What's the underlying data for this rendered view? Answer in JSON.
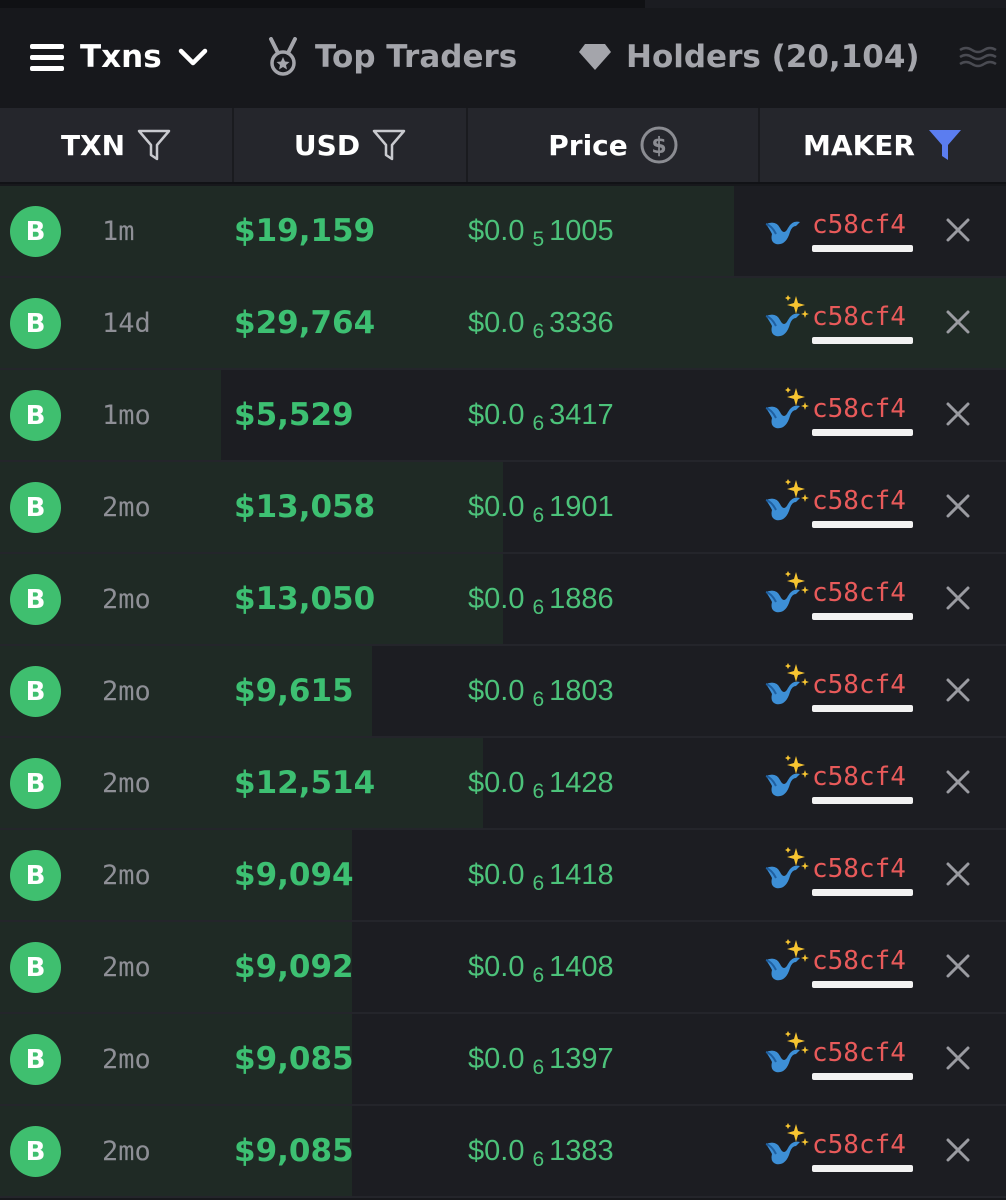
{
  "tabs": {
    "txns": "Txns",
    "top_traders": "Top Traders",
    "holders": "Holders (20,104)"
  },
  "header": {
    "txn": "TXN",
    "usd": "USD",
    "price": "Price",
    "maker": "MAKER"
  },
  "colors": {
    "buy_green": "#3dc072",
    "maker_red": "#e85a5a",
    "filter_active": "#5b7df0"
  },
  "rows": [
    {
      "type": "B",
      "age": "1m",
      "usd": "$19,159",
      "price_prefix": "$0.0",
      "price_zeros": "5",
      "price_digits": "1005",
      "maker": "c58cf4",
      "maker_icon": "whale-icon",
      "fill": 0.73
    },
    {
      "type": "B",
      "age": "14d",
      "usd": "$29,764",
      "price_prefix": "$0.0",
      "price_zeros": "6",
      "price_digits": "3336",
      "maker": "c58cf4",
      "maker_icon": "sparkle-whale-icon",
      "fill": 1.0
    },
    {
      "type": "B",
      "age": "1mo",
      "usd": "$5,529",
      "price_prefix": "$0.0",
      "price_zeros": "6",
      "price_digits": "3417",
      "maker": "c58cf4",
      "maker_icon": "sparkle-whale-icon",
      "fill": 0.22
    },
    {
      "type": "B",
      "age": "2mo",
      "usd": "$13,058",
      "price_prefix": "$0.0",
      "price_zeros": "6",
      "price_digits": "1901",
      "maker": "c58cf4",
      "maker_icon": "sparkle-whale-icon",
      "fill": 0.5
    },
    {
      "type": "B",
      "age": "2mo",
      "usd": "$13,050",
      "price_prefix": "$0.0",
      "price_zeros": "6",
      "price_digits": "1886",
      "maker": "c58cf4",
      "maker_icon": "sparkle-whale-icon",
      "fill": 0.5
    },
    {
      "type": "B",
      "age": "2mo",
      "usd": "$9,615",
      "price_prefix": "$0.0",
      "price_zeros": "6",
      "price_digits": "1803",
      "maker": "c58cf4",
      "maker_icon": "sparkle-whale-icon",
      "fill": 0.37
    },
    {
      "type": "B",
      "age": "2mo",
      "usd": "$12,514",
      "price_prefix": "$0.0",
      "price_zeros": "6",
      "price_digits": "1428",
      "maker": "c58cf4",
      "maker_icon": "sparkle-whale-icon",
      "fill": 0.48
    },
    {
      "type": "B",
      "age": "2mo",
      "usd": "$9,094",
      "price_prefix": "$0.0",
      "price_zeros": "6",
      "price_digits": "1418",
      "maker": "c58cf4",
      "maker_icon": "sparkle-whale-icon",
      "fill": 0.35
    },
    {
      "type": "B",
      "age": "2mo",
      "usd": "$9,092",
      "price_prefix": "$0.0",
      "price_zeros": "6",
      "price_digits": "1408",
      "maker": "c58cf4",
      "maker_icon": "sparkle-whale-icon",
      "fill": 0.35
    },
    {
      "type": "B",
      "age": "2mo",
      "usd": "$9,085",
      "price_prefix": "$0.0",
      "price_zeros": "6",
      "price_digits": "1397",
      "maker": "c58cf4",
      "maker_icon": "sparkle-whale-icon",
      "fill": 0.35
    },
    {
      "type": "B",
      "age": "2mo",
      "usd": "$9,085",
      "price_prefix": "$0.0",
      "price_zeros": "6",
      "price_digits": "1383",
      "maker": "c58cf4",
      "maker_icon": "sparkle-whale-icon",
      "fill": 0.35
    }
  ]
}
